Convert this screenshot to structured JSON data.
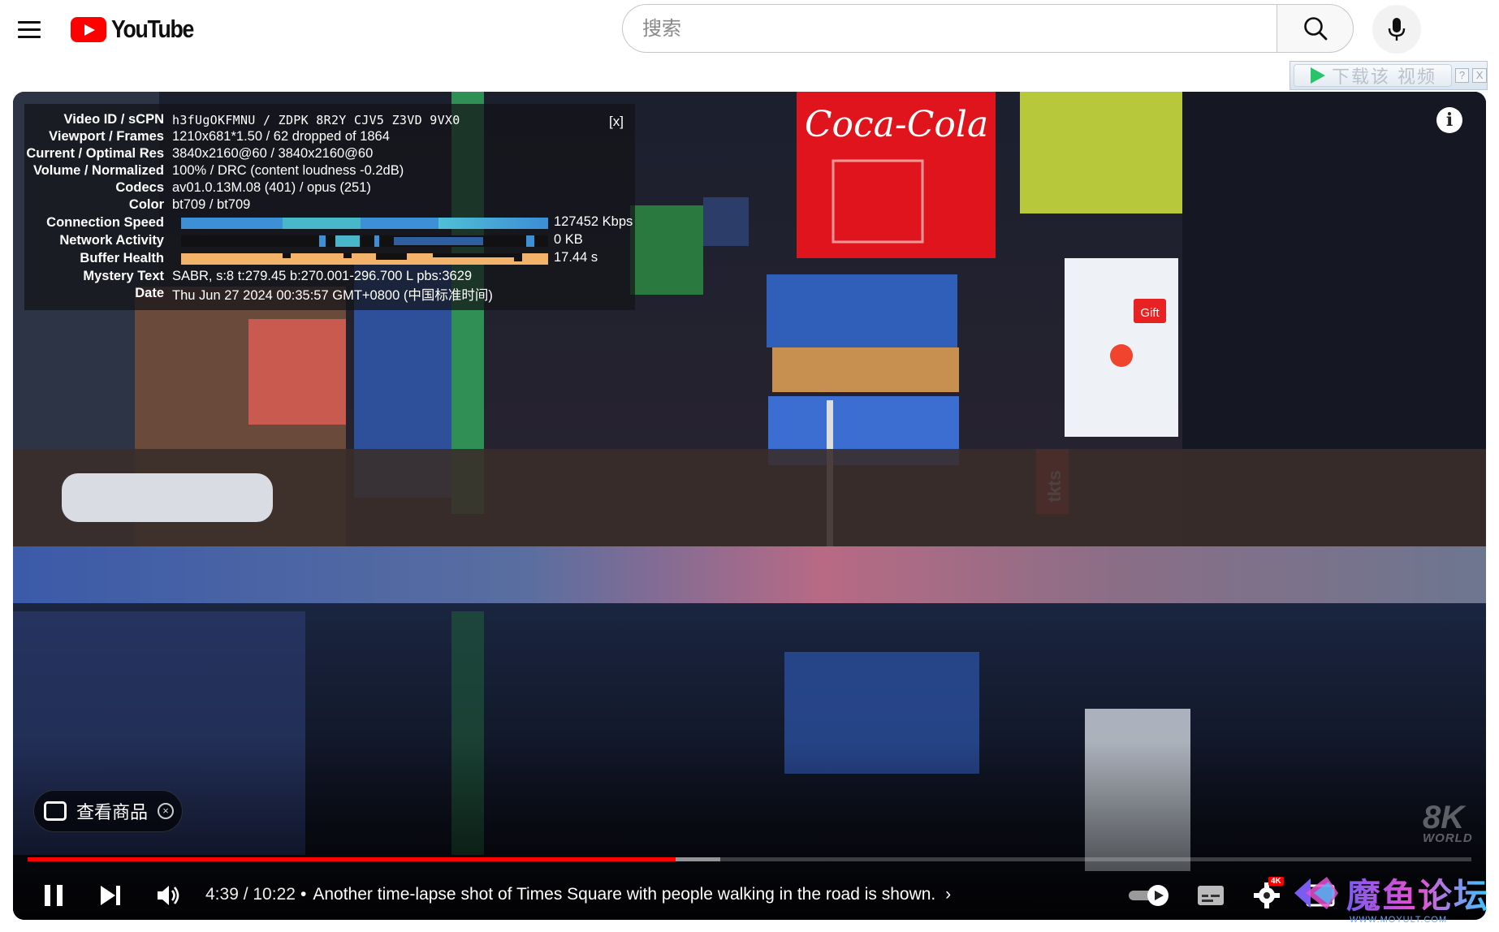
{
  "masthead": {
    "logo_text": "YouTube",
    "search_placeholder": "搜索",
    "download_button_label": "下载该 视频",
    "download_help": "?",
    "download_close": "X"
  },
  "stats": {
    "close": "[x]",
    "rows": [
      {
        "label": "Video ID / sCPN",
        "value": "h3fUgOKFMNU / ZDPK 8R2Y CJV5 Z3VD 9VX0"
      },
      {
        "label": "Viewport / Frames",
        "value": "1210x681*1.50 / 62 dropped of 1864"
      },
      {
        "label": "Current / Optimal Res",
        "value": "3840x2160@60 / 3840x2160@60"
      },
      {
        "label": "Volume / Normalized",
        "value": "100% / DRC (content loudness -0.2dB)"
      },
      {
        "label": "Codecs",
        "value": "av01.0.13M.08 (401) / opus (251)"
      },
      {
        "label": "Color",
        "value": "bt709 / bt709"
      },
      {
        "label": "Connection Speed",
        "value": "127452 Kbps"
      },
      {
        "label": "Network Activity",
        "value": "0 KB"
      },
      {
        "label": "Buffer Health",
        "value": "17.44 s"
      },
      {
        "label": "Mystery Text",
        "value": "SABR, s:8 t:279.45 b:270.001-296.700 L pbs:3629"
      },
      {
        "label": "Date",
        "value": "Thu Jun 27 2024 00:35:57 GMT+0800 (中国标准时间)"
      }
    ]
  },
  "player": {
    "info_icon": "i",
    "shop_label": "查看商品",
    "shop_close": "×",
    "watermark": "8K",
    "watermark_sub": "WORLD",
    "time_display": "4:39 / 10:22",
    "chapter_title": "Another time-lapse shot of Times Square with people walking in the road is shown.",
    "chapter_arrow": "›",
    "progress_played_fraction": 0.449,
    "progress_buffered_fraction": 0.48,
    "settings_badge": "4K"
  },
  "scene": {
    "coca_cola": "Coca-Cola",
    "tkts": "tkts",
    "gift": "Gift"
  },
  "overlay": {
    "forum_name": "魔鱼论坛",
    "forum_url": "WWW.MOYULT.COM"
  },
  "colors": {
    "brand_red": "#ff0000",
    "progress_red": "#ff0000",
    "connection_graph": "#3d8fd6",
    "buffer_graph": "#f4b36b"
  }
}
